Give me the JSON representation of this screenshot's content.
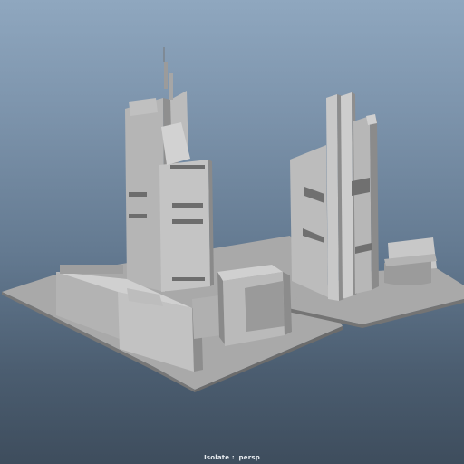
{
  "viewport": {
    "hud_label": "Isolate",
    "hud_separator": " : ",
    "camera_name": "persp",
    "colors": {
      "background_top": "#8fa7bf",
      "background_bottom": "#3e4d5d",
      "model_light": "#c9c9c9",
      "model_mid": "#a8a8a8",
      "model_dark": "#7a7a7a",
      "hud_text": "#e8ecf0"
    }
  }
}
